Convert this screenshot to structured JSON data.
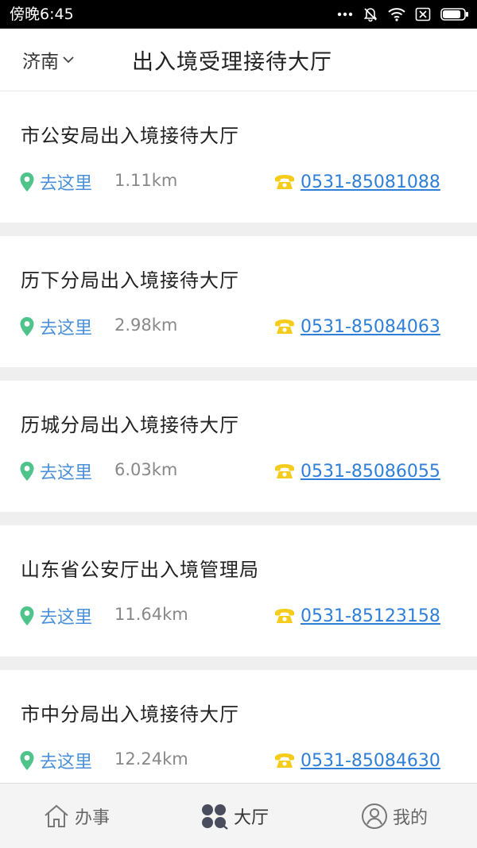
{
  "status_bar": {
    "time": "傍晚6:45",
    "battery_level": 0.85
  },
  "header": {
    "city": "济南",
    "title": "出入境受理接待大厅"
  },
  "offices": [
    {
      "name": "市公安局出入境接待大厅",
      "go_label": "去这里",
      "distance": "1.11km",
      "phone": "0531-85081088"
    },
    {
      "name": "历下分局出入境接待大厅",
      "go_label": "去这里",
      "distance": "2.98km",
      "phone": "0531-85084063"
    },
    {
      "name": "历城分局出入境接待大厅",
      "go_label": "去这里",
      "distance": "6.03km",
      "phone": "0531-85086055"
    },
    {
      "name": "山东省公安厅出入境管理局",
      "go_label": "去这里",
      "distance": "11.64km",
      "phone": "0531-85123158"
    },
    {
      "name": "市中分局出入境接待大厅",
      "go_label": "去这里",
      "distance": "12.24km",
      "phone": "0531-85084630"
    }
  ],
  "tabs": [
    {
      "label": "办事",
      "icon": "home-icon"
    },
    {
      "label": "大厅",
      "icon": "hall-icon"
    },
    {
      "label": "我的",
      "icon": "user-icon"
    }
  ],
  "colors": {
    "accent_blue": "#4a90d9",
    "link_blue": "#2f7fd6",
    "pin_green": "#4fc48a",
    "phone_yellow": "#f5cc1b"
  }
}
